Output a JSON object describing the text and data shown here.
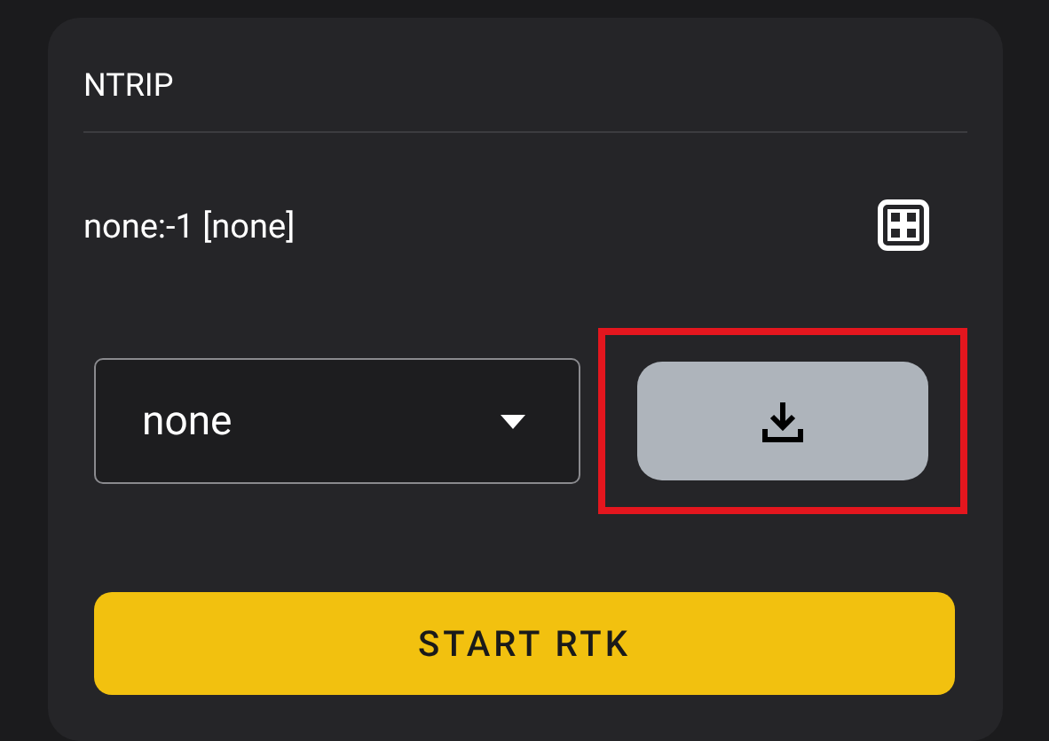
{
  "card": {
    "title": "NTRIP"
  },
  "source": {
    "label": "none:-1 [none]"
  },
  "dropdown": {
    "value": "none"
  },
  "download_button": {
    "highlighted": true
  },
  "start_button": {
    "label": "START RTK"
  }
}
